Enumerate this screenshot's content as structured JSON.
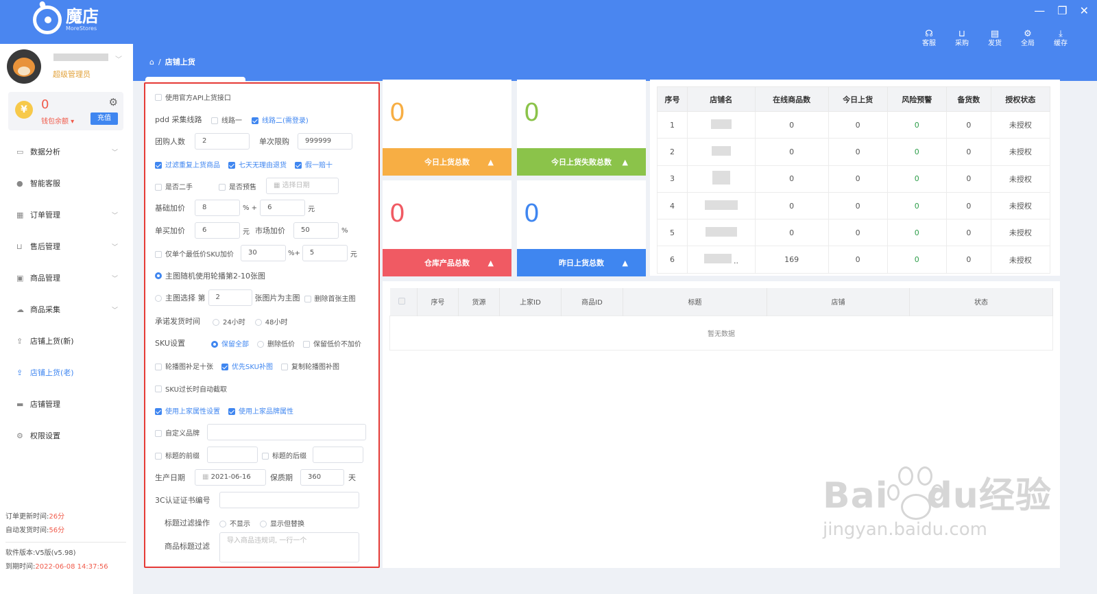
{
  "app": {
    "name": "魔店",
    "subtitle": "MoreStores"
  },
  "window_controls": [
    "—",
    "❐",
    "✕"
  ],
  "toolbar": [
    {
      "label": "客服",
      "icon": "headset-icon"
    },
    {
      "label": "采购",
      "icon": "cart-icon"
    },
    {
      "label": "发货",
      "icon": "truck-icon"
    },
    {
      "label": "全局",
      "icon": "settings-icon"
    },
    {
      "label": "缓存",
      "icon": "download-icon"
    }
  ],
  "breadcrumb": {
    "home_icon": "home-icon",
    "sep": "/",
    "current": "店铺上货"
  },
  "user": {
    "role": "超级管理员"
  },
  "wallet": {
    "amount": "0",
    "label": "钱包余额",
    "recharge": "充值",
    "currency": "¥"
  },
  "nav": [
    {
      "label": "数据分析",
      "icon": "monitor-icon",
      "chevron": true
    },
    {
      "label": "智能客服",
      "icon": "user-icon",
      "chevron": false
    },
    {
      "label": "订单管理",
      "icon": "clipboard-icon",
      "chevron": true
    },
    {
      "label": "售后管理",
      "icon": "cart-icon",
      "chevron": true
    },
    {
      "label": "商品管理",
      "icon": "bag-icon",
      "chevron": true
    },
    {
      "label": "商品采集",
      "icon": "cloud-icon",
      "chevron": true
    },
    {
      "label": "店铺上货(新)",
      "icon": "upload-icon",
      "chevron": false
    },
    {
      "label": "店铺上货(老)",
      "icon": "upload-icon",
      "chevron": false,
      "active": true
    },
    {
      "label": "店铺管理",
      "icon": "store-icon",
      "chevron": false
    },
    {
      "label": "权限设置",
      "icon": "gear-icon",
      "chevron": false
    }
  ],
  "sidefoot": {
    "order_update_label": "订单更新时间:",
    "order_update_val": "26分",
    "auto_ship_label": "自动发货时间:",
    "auto_ship_val": "56分",
    "version_label": "软件版本:",
    "version_val": "V5版(v5.98)",
    "expire_label": "到期时间:",
    "expire_val": "2022-06-08 14:37:56"
  },
  "form": {
    "official_api": "使用官方API上货接口",
    "pdd_route_label": "pdd 采集线路",
    "route1": "线路一",
    "route2": "线路二(需登录)",
    "group_label": "团购人数",
    "group_val": "2",
    "limit_label": "单次限购",
    "limit_val": "999999",
    "filter_dup": "过滤重复上货商品",
    "seven_day": "七天无理由退货",
    "fake_ten": "假一赔十",
    "second_hand": "是否二手",
    "presale": "是否预售",
    "date_ph": "选择日期",
    "base_label": "基础加价",
    "base_pct": "8",
    "pct_plus": "% +",
    "base_yuan": "6",
    "yuan": "元",
    "single_label": "单买加价",
    "single_val": "6",
    "market_label": "市场加价",
    "market_val": "50",
    "pct": "%",
    "lowest_sku": "仅单个最低价SKU加价",
    "lowest_pct": "30",
    "pct_plus2": "%+",
    "lowest_yuan": "5",
    "main_random": "主图随机使用轮播第2-10张图",
    "main_pick_a": "主图选择 第",
    "main_pick_val": "2",
    "main_pick_b": "张图片为主图",
    "delete_first": "删除首张主图",
    "promise_label": "承诺发货时间",
    "h24": "24小时",
    "h48": "48小时",
    "sku_label": "SKU设置",
    "keep_all": "保留全部",
    "del_low": "删除低价",
    "keep_low": "保留低价不加价",
    "fill_ten": "轮播图补足十张",
    "sku_first": "优先SKU补图",
    "copy_carousel": "复制轮播图补图",
    "sku_trunc": "SKU过长时自动截取",
    "use_attr": "使用上家属性设置",
    "use_brand": "使用上家品牌属性",
    "custom_brand": "自定义品牌",
    "title_prefix": "标题的前缀",
    "title_suffix": "标题的后缀",
    "prod_date_label": "生产日期",
    "prod_date_val": "2021-06-16",
    "shelf_label": "保质期",
    "shelf_val": "360",
    "day": "天",
    "ccc_label": "3C认证证书编号",
    "title_filter_label": "标题过滤操作",
    "hide": "不显示",
    "show_replace": "显示但替换",
    "goods_filter_label": "商品标题过滤",
    "goods_filter_ph": "导入商品违规词, 一行一个"
  },
  "cards": [
    {
      "value": "0",
      "label": "今日上货总数",
      "color": "#f7ae44"
    },
    {
      "value": "0",
      "label": "今日上货失败总数",
      "color": "#8bc34a"
    },
    {
      "value": "0",
      "label": "仓库产品总数",
      "color": "#f05a63"
    },
    {
      "value": "0",
      "label": "昨日上货总数",
      "color": "#3f86f0"
    }
  ],
  "store_table": {
    "headers": [
      "序号",
      "店铺名",
      "在线商品数",
      "今日上货",
      "风险预警",
      "备货数",
      "授权状态"
    ],
    "rows": [
      [
        "1",
        "",
        "0",
        "0",
        "0",
        "0",
        "未授权"
      ],
      [
        "2",
        "",
        "0",
        "0",
        "0",
        "0",
        "未授权"
      ],
      [
        "3",
        "",
        "0",
        "0",
        "0",
        "0",
        "未授权"
      ],
      [
        "4",
        "",
        "0",
        "0",
        "0",
        "0",
        "未授权"
      ],
      [
        "5",
        "",
        "0",
        "0",
        "0",
        "0",
        "未授权"
      ],
      [
        "6",
        "..",
        "169",
        "0",
        "0",
        "0",
        "未授权"
      ]
    ]
  },
  "goods_table": {
    "headers": [
      "序号",
      "货源",
      "上家ID",
      "商品ID",
      "标题",
      "店铺",
      "状态"
    ],
    "empty": "暂无数据"
  },
  "watermark": {
    "line1": "Bai",
    "line1b": "du",
    "line1c": "经验",
    "line2": "jingyan.baidu.com"
  }
}
